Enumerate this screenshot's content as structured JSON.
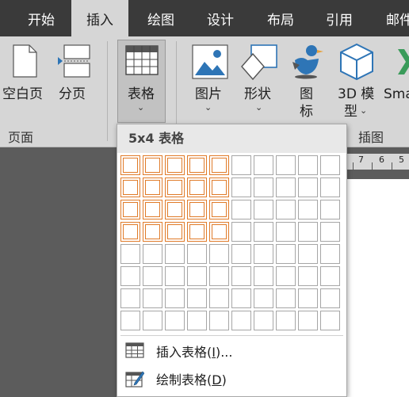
{
  "tabs": [
    {
      "label": "开始",
      "active": false
    },
    {
      "label": "插入",
      "active": true
    },
    {
      "label": "绘图",
      "active": false
    },
    {
      "label": "设计",
      "active": false
    },
    {
      "label": "布局",
      "active": false
    },
    {
      "label": "引用",
      "active": false
    },
    {
      "label": "邮件",
      "active": false
    }
  ],
  "ribbon": {
    "blank_page": {
      "label": "空白页",
      "icon": "blank-page-icon"
    },
    "page_break": {
      "label": "分页",
      "icon": "page-break-icon"
    },
    "pages_group_label": "页面",
    "table": {
      "label": "表格",
      "chevron": "⌄",
      "icon": "table-icon"
    },
    "pictures": {
      "label": "图片",
      "chevron": "⌄",
      "icon": "picture-icon"
    },
    "shapes": {
      "label": "形状",
      "chevron": "⌄",
      "icon": "shapes-icon"
    },
    "icons": {
      "label_line1": "图",
      "label_line2": "标",
      "icon": "icons-bird-icon"
    },
    "model3d": {
      "label_line1": "3D 模",
      "label_line2": "型",
      "chevron": "⌄",
      "icon": "cube-3d-icon"
    },
    "smartart": {
      "label": "Sma",
      "icon": "smartart-icon"
    },
    "illustrations_group_label": "插图"
  },
  "ruler": {
    "labels": [
      "7",
      "6",
      "5"
    ]
  },
  "dropdown": {
    "header": "5x4 表格",
    "grid": {
      "columns": 10,
      "rows": 8,
      "selected_columns": 5,
      "selected_rows": 4
    },
    "insert_table": {
      "label_main": "插入表格(",
      "label_key": "I",
      "label_end": ")...",
      "icon": "insert-table-icon"
    },
    "draw_table": {
      "label_main": "绘制表格(",
      "label_key": "D",
      "label_end": ")",
      "icon": "draw-table-icon"
    }
  },
  "colors": {
    "tab_bar": "#3a3a3a",
    "ribbon": "#d6d6d6",
    "highlight": "#e07b29",
    "workspace": "#5c5c5c"
  }
}
